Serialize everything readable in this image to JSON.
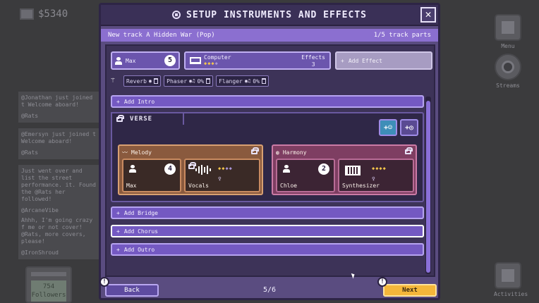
{
  "hud": {
    "money": "$5340"
  },
  "feed": [
    {
      "text": "@Jonathan just joined t Welcome aboard!",
      "user": "@Rats"
    },
    {
      "text": "@Emersyn just joined t Welcome aboard!",
      "user": "@Rats"
    },
    {
      "text": "Just went over and list the street performance. it. Found the @Rats her followed!",
      "user": "@ArcaneVibe"
    },
    {
      "text": "Ahhh, I'm going crazy f me or not cover! @Rats, more covers, please!",
      "user": "@IronShroud"
    }
  ],
  "followers": {
    "count": "754",
    "label": "Followers"
  },
  "side": {
    "menu": "Menu",
    "streams": "Streams",
    "activities": "Activities"
  },
  "dialog": {
    "title": "SETUP INSTRUMENTS AND EFFECTS",
    "close": "✕",
    "track_name": "New track A Hidden War (Pop)",
    "track_parts": "1/5 track parts",
    "singer": {
      "name": "Max",
      "number": "5"
    },
    "instrument": {
      "name": "Computer",
      "stars": 3,
      "effects_label": "Effects",
      "effects_count": "3"
    },
    "add_effect": "Add Effect",
    "effects": [
      {
        "name": "Reverb",
        "value": ""
      },
      {
        "name": "Phaser",
        "value": "0%"
      },
      {
        "name": "Flanger",
        "value": "0%"
      }
    ],
    "sections": {
      "intro": "Add Intro",
      "bridge": "Add Bridge",
      "chorus": "Add Chorus",
      "outro": "Add Outro"
    },
    "verse": {
      "title": "VERSE",
      "melody": {
        "label": "Melody",
        "performer": {
          "name": "Max",
          "number": "4"
        },
        "instrument": {
          "name": "Vocals",
          "stars": 2
        }
      },
      "harmony": {
        "label": "Harmony",
        "performer": {
          "name": "Chloe",
          "number": "2"
        },
        "instrument": {
          "name": "Synthesizer",
          "stars": 4
        }
      }
    },
    "page": "5/6",
    "back": "Back",
    "next": "Next"
  },
  "colors": {
    "accent": "#7459c2",
    "next": "#f4b63a",
    "melody": "#8a5a3e",
    "harmony": "#7e3e62"
  }
}
